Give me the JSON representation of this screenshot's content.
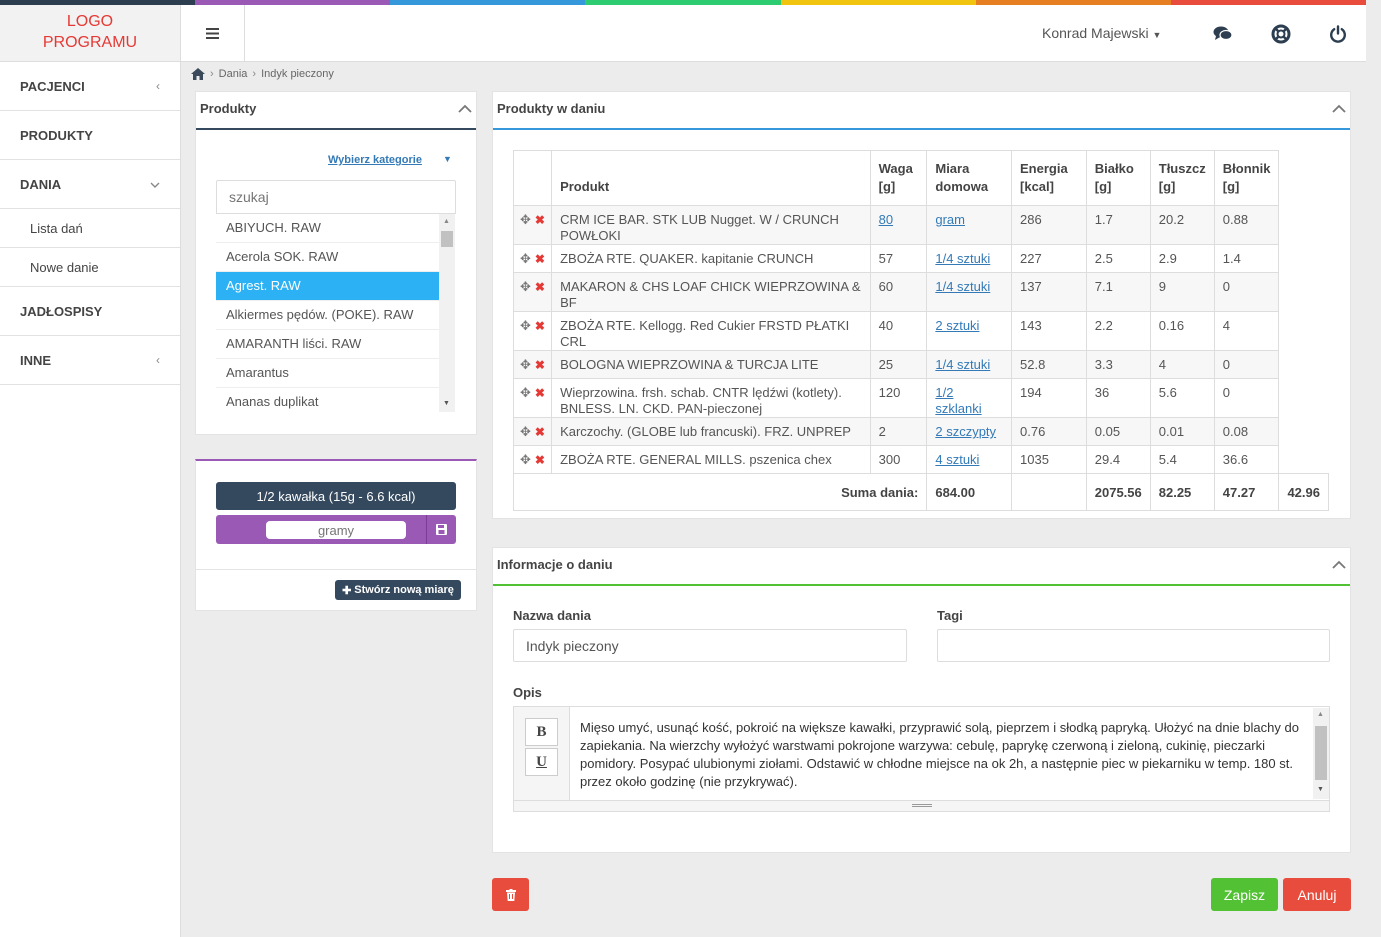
{
  "colors": {
    "stripe": [
      "#2c3e50",
      "#9b59b6",
      "#3498db",
      "#2ecc71",
      "#f1c40f",
      "#e67e22",
      "#e74c3c"
    ],
    "accent_blue": "#2cb1f5",
    "purple": "#9b59b6",
    "dark": "#34495e",
    "green": "#52c234",
    "red": "#e74c3c"
  },
  "logo": {
    "line1": "LOGO",
    "line2": "PROGRAMU"
  },
  "sidebar": {
    "items": [
      {
        "label": "PACJENCI",
        "chevron": "chevron-left-icon"
      },
      {
        "label": "PRODUKTY"
      },
      {
        "label": "DANIA",
        "chevron": "chevron-down-icon"
      },
      {
        "label": "JADŁOSPISY"
      },
      {
        "label": "INNE",
        "chevron": "chevron-left-icon"
      }
    ],
    "subitems": [
      "Lista dań",
      "Nowe danie"
    ]
  },
  "header": {
    "user": "Konrad Majewski",
    "icons": [
      "comments-icon",
      "lifebuoy-icon",
      "power-icon"
    ]
  },
  "breadcrumb": {
    "home_icon": "home-icon",
    "items": [
      "Dania",
      "Indyk pieczony"
    ]
  },
  "products_panel": {
    "title": "Produkty",
    "category_link": "Wybierz kategorie",
    "search_placeholder": "szukaj",
    "items": [
      "ABIYUCH. RAW",
      "Acerola SOK. RAW",
      "Agrest. RAW",
      "Alkiermes pędów. (POKE). RAW",
      "AMARANTH liści. RAW",
      "Amarantus",
      "Ananas duplikat"
    ],
    "selected_index": 2
  },
  "measure_panel": {
    "measure_label": "1/2 kawałka (15g - 6.6 kcal)",
    "grams_placeholder": "gramy",
    "create_button": "Stwórz nową miarę"
  },
  "dish_products": {
    "title": "Produkty w daniu",
    "headers": {
      "produkt": "Produkt",
      "waga": [
        "Waga",
        "[g]"
      ],
      "miara": [
        "Miara",
        "domowa"
      ],
      "energia": [
        "Energia",
        "[kcal]"
      ],
      "bialko": [
        "Białko",
        "[g]"
      ],
      "tluszcz": [
        "Tłuszcz",
        "[g]"
      ],
      "blonnik": [
        "Błonnik",
        "[g]"
      ]
    },
    "rows": [
      {
        "produkt": "CRM ICE BAR. STK LUB Nugget. W / CRUNCH POWŁOKI",
        "waga": "80",
        "waga_link": true,
        "miara": "gram",
        "energia": "286",
        "bialko": "1.7",
        "tluszcz": "20.2",
        "blonnik": "0.88"
      },
      {
        "produkt": "ZBOŻA RTE. QUAKER. kapitanie CRUNCH",
        "waga": "57",
        "miara": "1/4 sztuki",
        "energia": "227",
        "bialko": "2.5",
        "tluszcz": "2.9",
        "blonnik": "1.4"
      },
      {
        "produkt": "MAKARON & CHS LOAF CHICK WIEPRZOWINA & BF",
        "waga": "60",
        "miara": "1/4 sztuki",
        "energia": "137",
        "bialko": "7.1",
        "tluszcz": "9",
        "blonnik": "0"
      },
      {
        "produkt": "ZBOŻA RTE. Kellogg. Red Cukier FRSTD PŁATKI CRL",
        "waga": "40",
        "miara": "2 sztuki",
        "energia": "143",
        "bialko": "2.2",
        "tluszcz": "0.16",
        "blonnik": "4"
      },
      {
        "produkt": "BOLOGNA WIEPRZOWINA & TURCJA LITE",
        "waga": "25",
        "miara": "1/4 sztuki",
        "energia": "52.8",
        "bialko": "3.3",
        "tluszcz": "4",
        "blonnik": "0"
      },
      {
        "produkt": "Wieprzowina. frsh. schab. CNTR lędźwi (kotlety). BNLESS. LN. CKD. PAN-pieczonej",
        "waga": "120",
        "miara": "1/2 szklanki",
        "energia": "194",
        "bialko": "36",
        "tluszcz": "5.6",
        "blonnik": "0"
      },
      {
        "produkt": "Karczochy. (GLOBE lub francuski). FRZ. UNPREP",
        "waga": "2",
        "miara": "2 szczypty",
        "energia": "0.76",
        "bialko": "0.05",
        "tluszcz": "0.01",
        "blonnik": "0.08"
      },
      {
        "produkt": "ZBOŻA RTE. GENERAL MILLS. pszenica chex",
        "waga": "300",
        "miara": "4 sztuki",
        "energia": "1035",
        "bialko": "29.4",
        "tluszcz": "5.4",
        "blonnik": "36.6"
      }
    ],
    "sum": {
      "label": "Suma dania:",
      "waga": "684.00",
      "energia": "2075.56",
      "bialko": "82.25",
      "tluszcz": "47.27",
      "blonnik": "42.96"
    }
  },
  "dish_info": {
    "title": "Informacje o daniu",
    "name_label": "Nazwa dania",
    "name_value": "Indyk pieczony",
    "tags_label": "Tagi",
    "tags_value": "",
    "desc_label": "Opis",
    "bold_btn": "B",
    "underline_btn": "U",
    "desc_text": "Mięso umyć, usunąć kość, pokroić na większe kawałki, przyprawić solą, pieprzem i słodką papryką. Ułożyć na dnie blachy do zapiekania. Na wierzchy wyłożyć warstwami pokrojone warzywa: cebulę, paprykę czerwoną i zieloną, cukinię, pieczarki pomidory. Posypać ulubionymi ziołami. Odstawić w chłodne miejsce na ok 2h, a następnie piec w piekarniku w temp. 180 st. przez około godzinę (nie przykrywać)."
  },
  "actions": {
    "delete_icon": "trash-icon",
    "save": "Zapisz",
    "cancel": "Anuluj"
  }
}
